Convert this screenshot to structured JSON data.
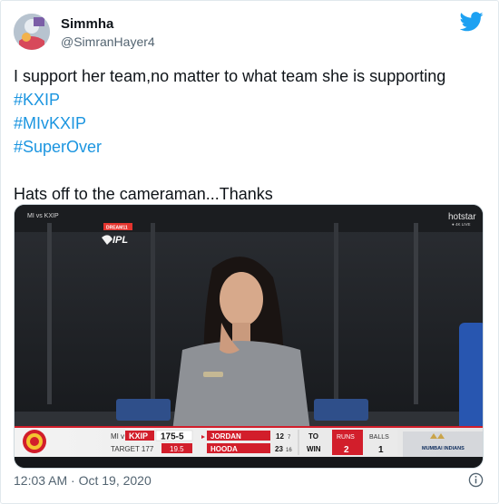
{
  "tweet": {
    "display_name": "Simmha",
    "handle": "@SimranHayer4",
    "lines": [
      {
        "text": "I support her team,no matter to what team she is supporting",
        "hashtag": false
      },
      {
        "text": "#KXIP",
        "hashtag": true
      },
      {
        "text": "#MIvKXIP",
        "hashtag": true
      },
      {
        "text": "#SuperOver",
        "hashtag": true
      }
    ],
    "closing_line": "Hats off to the cameraman...Thanks",
    "timestamp": "12:03 AM · Oct 19, 2020",
    "icons": {
      "platform": "twitter-bird-icon",
      "info": "info-icon"
    },
    "colors": {
      "hashtag": "#1b95e0",
      "secondary_text": "#536471",
      "bird": "#1da1f2"
    }
  },
  "media": {
    "top_left_caption": "MI vs KXIP",
    "ipl_badge": "DREAM11",
    "ipl_logo": "IPL",
    "broadcaster": "hotstar",
    "broadcaster_sub": "● 4K LIVE",
    "scorebar": {
      "teams": "MI v",
      "batting_team": "KXIP",
      "score": "175-5",
      "target": "TARGET 177",
      "overs": "19.5",
      "batter1": "JORDAN",
      "batter1_runs": "12",
      "batter1_balls": "7",
      "batter2": "HOODA",
      "batter2_runs": "23",
      "batter2_balls": "16",
      "to_win_1": "TO",
      "to_win_2": "WIN",
      "runs_label": "RUNS",
      "runs_value": "2",
      "balls_label": "BALLS",
      "balls_value": "1",
      "sponsor": "MUMBAI INDIANS",
      "colors": {
        "red": "#d21e2b",
        "navy": "#0b2a5b",
        "gold": "#c9a44a"
      }
    }
  }
}
